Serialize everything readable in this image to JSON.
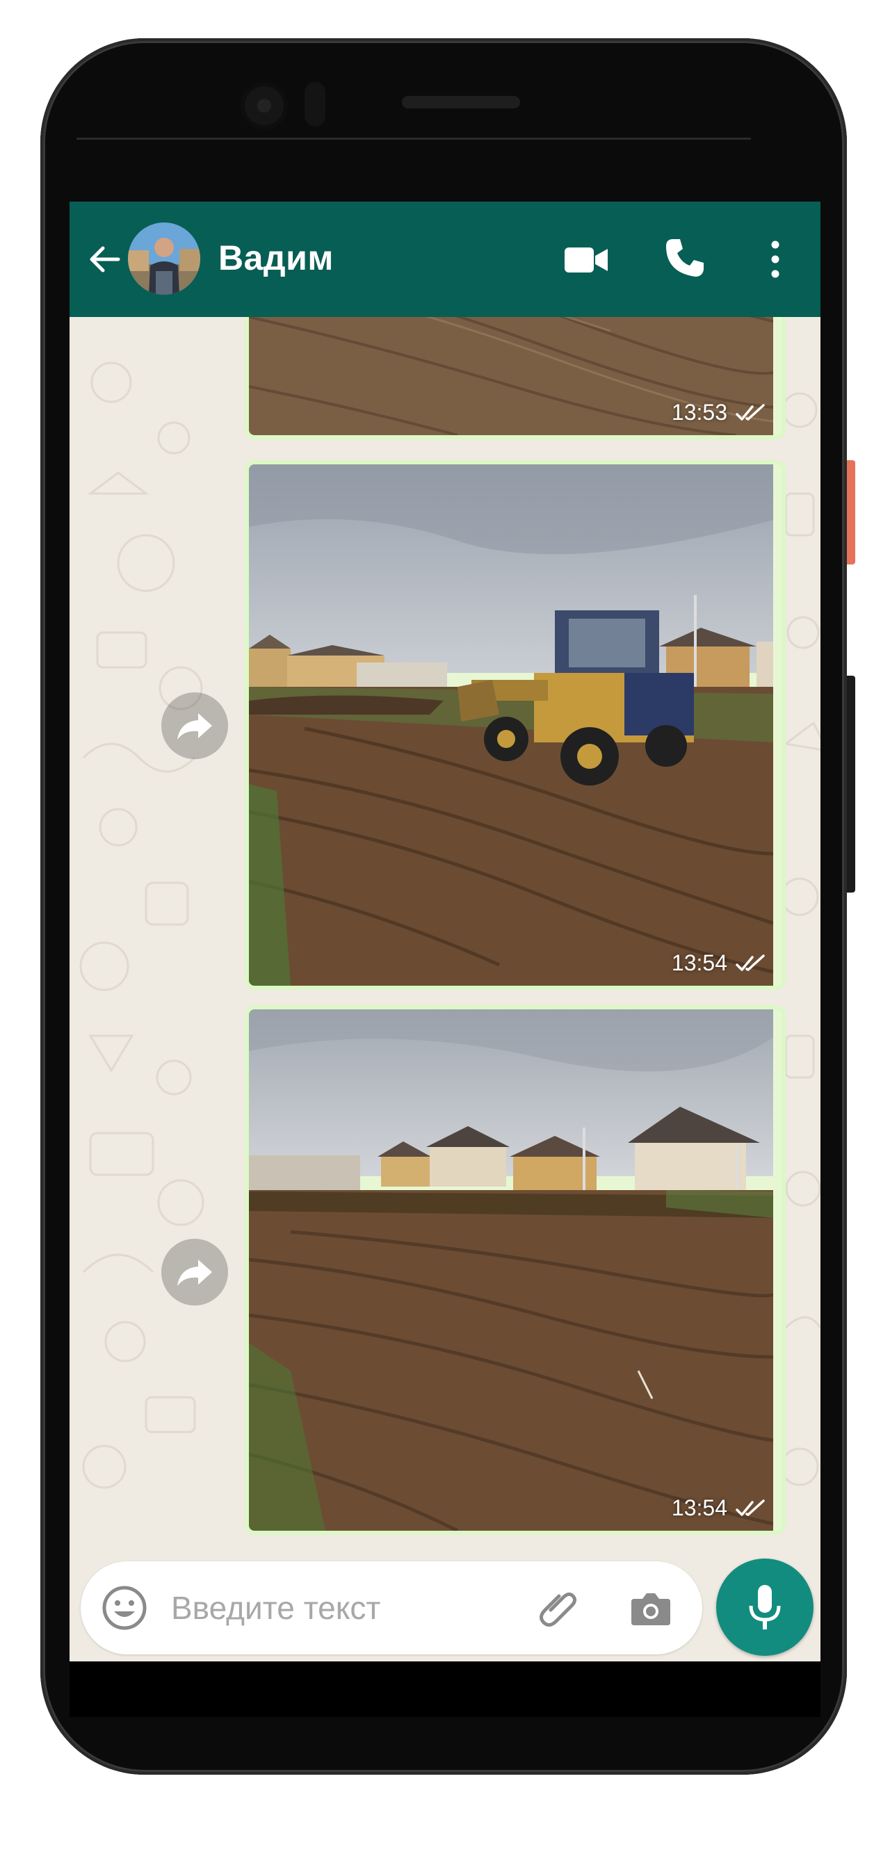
{
  "header": {
    "contact_name": "Вадим"
  },
  "messages": [
    {
      "time": "13:53",
      "status": "read"
    },
    {
      "time": "13:54",
      "status": "read"
    },
    {
      "time": "13:54",
      "status": "read"
    }
  ],
  "composer": {
    "placeholder": "Введите текст"
  },
  "colors": {
    "header": "#075e54",
    "bubble_border": "#dcf8c6",
    "mic_button": "#128c7e",
    "chat_background": "#efeae2"
  },
  "icons": [
    "back-arrow-icon",
    "video-call-icon",
    "phone-call-icon",
    "more-options-icon",
    "forward-icon",
    "double-check-icon",
    "emoji-icon",
    "paperclip-icon",
    "camera-icon",
    "microphone-icon"
  ]
}
